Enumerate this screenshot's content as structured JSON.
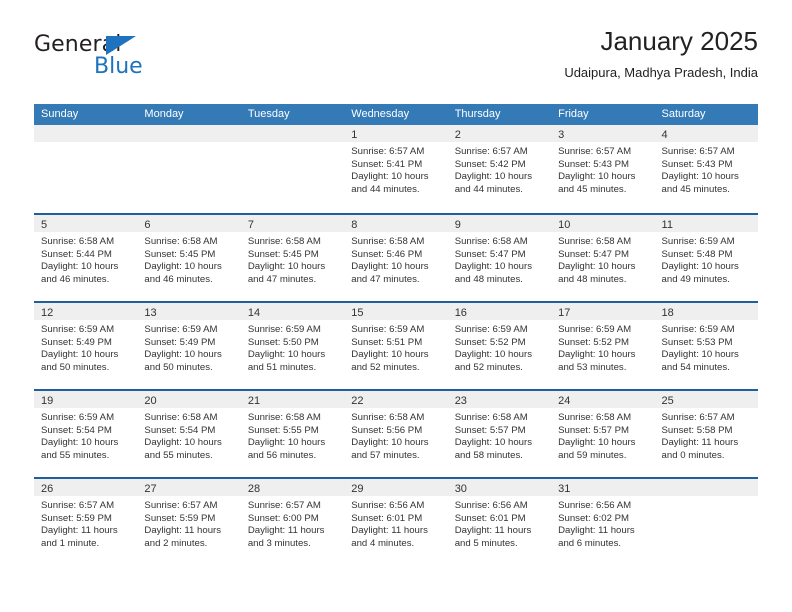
{
  "logo": {
    "word1": "General",
    "word2": "Blue",
    "triangle_color": "#1f72bd"
  },
  "header": {
    "title": "January 2025",
    "subtitle": "Udaipura, Madhya Pradesh, India"
  },
  "theme": {
    "header_blue": "#337ab7",
    "divider_blue": "#1f5fa0",
    "day_strip_gray": "#efefef"
  },
  "weekdays": [
    "Sunday",
    "Monday",
    "Tuesday",
    "Wednesday",
    "Thursday",
    "Friday",
    "Saturday"
  ],
  "weeks": [
    [
      {
        "day": "",
        "sunrise": "",
        "sunset": "",
        "daylight1": "",
        "daylight2": ""
      },
      {
        "day": "",
        "sunrise": "",
        "sunset": "",
        "daylight1": "",
        "daylight2": ""
      },
      {
        "day": "",
        "sunrise": "",
        "sunset": "",
        "daylight1": "",
        "daylight2": ""
      },
      {
        "day": "1",
        "sunrise": "Sunrise: 6:57 AM",
        "sunset": "Sunset: 5:41 PM",
        "daylight1": "Daylight: 10 hours",
        "daylight2": "and 44 minutes."
      },
      {
        "day": "2",
        "sunrise": "Sunrise: 6:57 AM",
        "sunset": "Sunset: 5:42 PM",
        "daylight1": "Daylight: 10 hours",
        "daylight2": "and 44 minutes."
      },
      {
        "day": "3",
        "sunrise": "Sunrise: 6:57 AM",
        "sunset": "Sunset: 5:43 PM",
        "daylight1": "Daylight: 10 hours",
        "daylight2": "and 45 minutes."
      },
      {
        "day": "4",
        "sunrise": "Sunrise: 6:57 AM",
        "sunset": "Sunset: 5:43 PM",
        "daylight1": "Daylight: 10 hours",
        "daylight2": "and 45 minutes."
      }
    ],
    [
      {
        "day": "5",
        "sunrise": "Sunrise: 6:58 AM",
        "sunset": "Sunset: 5:44 PM",
        "daylight1": "Daylight: 10 hours",
        "daylight2": "and 46 minutes."
      },
      {
        "day": "6",
        "sunrise": "Sunrise: 6:58 AM",
        "sunset": "Sunset: 5:45 PM",
        "daylight1": "Daylight: 10 hours",
        "daylight2": "and 46 minutes."
      },
      {
        "day": "7",
        "sunrise": "Sunrise: 6:58 AM",
        "sunset": "Sunset: 5:45 PM",
        "daylight1": "Daylight: 10 hours",
        "daylight2": "and 47 minutes."
      },
      {
        "day": "8",
        "sunrise": "Sunrise: 6:58 AM",
        "sunset": "Sunset: 5:46 PM",
        "daylight1": "Daylight: 10 hours",
        "daylight2": "and 47 minutes."
      },
      {
        "day": "9",
        "sunrise": "Sunrise: 6:58 AM",
        "sunset": "Sunset: 5:47 PM",
        "daylight1": "Daylight: 10 hours",
        "daylight2": "and 48 minutes."
      },
      {
        "day": "10",
        "sunrise": "Sunrise: 6:58 AM",
        "sunset": "Sunset: 5:47 PM",
        "daylight1": "Daylight: 10 hours",
        "daylight2": "and 48 minutes."
      },
      {
        "day": "11",
        "sunrise": "Sunrise: 6:59 AM",
        "sunset": "Sunset: 5:48 PM",
        "daylight1": "Daylight: 10 hours",
        "daylight2": "and 49 minutes."
      }
    ],
    [
      {
        "day": "12",
        "sunrise": "Sunrise: 6:59 AM",
        "sunset": "Sunset: 5:49 PM",
        "daylight1": "Daylight: 10 hours",
        "daylight2": "and 50 minutes."
      },
      {
        "day": "13",
        "sunrise": "Sunrise: 6:59 AM",
        "sunset": "Sunset: 5:49 PM",
        "daylight1": "Daylight: 10 hours",
        "daylight2": "and 50 minutes."
      },
      {
        "day": "14",
        "sunrise": "Sunrise: 6:59 AM",
        "sunset": "Sunset: 5:50 PM",
        "daylight1": "Daylight: 10 hours",
        "daylight2": "and 51 minutes."
      },
      {
        "day": "15",
        "sunrise": "Sunrise: 6:59 AM",
        "sunset": "Sunset: 5:51 PM",
        "daylight1": "Daylight: 10 hours",
        "daylight2": "and 52 minutes."
      },
      {
        "day": "16",
        "sunrise": "Sunrise: 6:59 AM",
        "sunset": "Sunset: 5:52 PM",
        "daylight1": "Daylight: 10 hours",
        "daylight2": "and 52 minutes."
      },
      {
        "day": "17",
        "sunrise": "Sunrise: 6:59 AM",
        "sunset": "Sunset: 5:52 PM",
        "daylight1": "Daylight: 10 hours",
        "daylight2": "and 53 minutes."
      },
      {
        "day": "18",
        "sunrise": "Sunrise: 6:59 AM",
        "sunset": "Sunset: 5:53 PM",
        "daylight1": "Daylight: 10 hours",
        "daylight2": "and 54 minutes."
      }
    ],
    [
      {
        "day": "19",
        "sunrise": "Sunrise: 6:59 AM",
        "sunset": "Sunset: 5:54 PM",
        "daylight1": "Daylight: 10 hours",
        "daylight2": "and 55 minutes."
      },
      {
        "day": "20",
        "sunrise": "Sunrise: 6:58 AM",
        "sunset": "Sunset: 5:54 PM",
        "daylight1": "Daylight: 10 hours",
        "daylight2": "and 55 minutes."
      },
      {
        "day": "21",
        "sunrise": "Sunrise: 6:58 AM",
        "sunset": "Sunset: 5:55 PM",
        "daylight1": "Daylight: 10 hours",
        "daylight2": "and 56 minutes."
      },
      {
        "day": "22",
        "sunrise": "Sunrise: 6:58 AM",
        "sunset": "Sunset: 5:56 PM",
        "daylight1": "Daylight: 10 hours",
        "daylight2": "and 57 minutes."
      },
      {
        "day": "23",
        "sunrise": "Sunrise: 6:58 AM",
        "sunset": "Sunset: 5:57 PM",
        "daylight1": "Daylight: 10 hours",
        "daylight2": "and 58 minutes."
      },
      {
        "day": "24",
        "sunrise": "Sunrise: 6:58 AM",
        "sunset": "Sunset: 5:57 PM",
        "daylight1": "Daylight: 10 hours",
        "daylight2": "and 59 minutes."
      },
      {
        "day": "25",
        "sunrise": "Sunrise: 6:57 AM",
        "sunset": "Sunset: 5:58 PM",
        "daylight1": "Daylight: 11 hours",
        "daylight2": "and 0 minutes."
      }
    ],
    [
      {
        "day": "26",
        "sunrise": "Sunrise: 6:57 AM",
        "sunset": "Sunset: 5:59 PM",
        "daylight1": "Daylight: 11 hours",
        "daylight2": "and 1 minute."
      },
      {
        "day": "27",
        "sunrise": "Sunrise: 6:57 AM",
        "sunset": "Sunset: 5:59 PM",
        "daylight1": "Daylight: 11 hours",
        "daylight2": "and 2 minutes."
      },
      {
        "day": "28",
        "sunrise": "Sunrise: 6:57 AM",
        "sunset": "Sunset: 6:00 PM",
        "daylight1": "Daylight: 11 hours",
        "daylight2": "and 3 minutes."
      },
      {
        "day": "29",
        "sunrise": "Sunrise: 6:56 AM",
        "sunset": "Sunset: 6:01 PM",
        "daylight1": "Daylight: 11 hours",
        "daylight2": "and 4 minutes."
      },
      {
        "day": "30",
        "sunrise": "Sunrise: 6:56 AM",
        "sunset": "Sunset: 6:01 PM",
        "daylight1": "Daylight: 11 hours",
        "daylight2": "and 5 minutes."
      },
      {
        "day": "31",
        "sunrise": "Sunrise: 6:56 AM",
        "sunset": "Sunset: 6:02 PM",
        "daylight1": "Daylight: 11 hours",
        "daylight2": "and 6 minutes."
      },
      {
        "day": "",
        "sunrise": "",
        "sunset": "",
        "daylight1": "",
        "daylight2": ""
      }
    ]
  ]
}
